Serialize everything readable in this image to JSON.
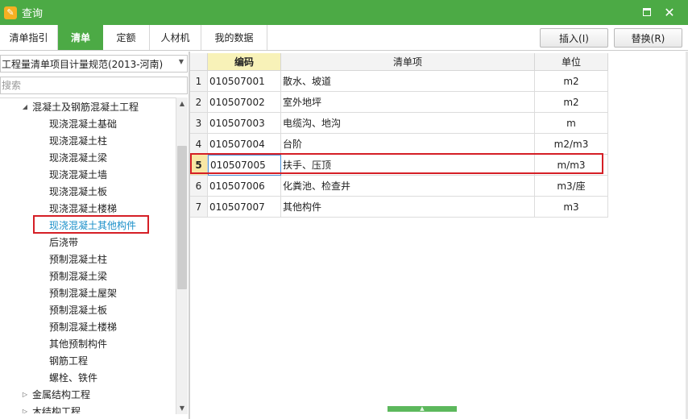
{
  "window": {
    "title": "查询",
    "app_icon": "query-app-icon"
  },
  "tabs": [
    {
      "label": "清单指引",
      "active": false
    },
    {
      "label": "清单",
      "active": true
    },
    {
      "label": "定额",
      "active": false
    },
    {
      "label": "人材机",
      "active": false
    },
    {
      "label": "我的数据",
      "active": false
    }
  ],
  "toolbar": {
    "insert_label": "插入(I)",
    "replace_label": "替换(R)"
  },
  "left_panel": {
    "spec_select": "工程量清单项目计量规范(2013-河南)",
    "search_placeholder": "搜索",
    "tree": {
      "parent": "混凝土及钢筋混凝土工程",
      "children": [
        "现浇混凝土基础",
        "现浇混凝土柱",
        "现浇混凝土梁",
        "现浇混凝土墙",
        "现浇混凝土板",
        "现浇混凝土楼梯",
        "现浇混凝土其他构件",
        "后浇带",
        "预制混凝土柱",
        "预制混凝土梁",
        "预制混凝土屋架",
        "预制混凝土板",
        "预制混凝土楼梯",
        "其他预制构件",
        "钢筋工程",
        "螺栓、铁件"
      ],
      "selected_index": 6,
      "siblings": [
        "金属结构工程",
        "木结构工程"
      ]
    }
  },
  "grid": {
    "columns": {
      "code": "编码",
      "name": "清单项",
      "unit": "单位"
    },
    "rows": [
      {
        "num": "1",
        "code": "010507001",
        "name": "散水、坡道",
        "unit": "m2"
      },
      {
        "num": "2",
        "code": "010507002",
        "name": "室外地坪",
        "unit": "m2"
      },
      {
        "num": "3",
        "code": "010507003",
        "name": "电缆沟、地沟",
        "unit": "m"
      },
      {
        "num": "4",
        "code": "010507004",
        "name": "台阶",
        "unit": "m2/m3"
      },
      {
        "num": "5",
        "code": "010507005",
        "name": "扶手、压顶",
        "unit": "m/m3"
      },
      {
        "num": "6",
        "code": "010507006",
        "name": "化粪池、检查井",
        "unit": "m3/座"
      },
      {
        "num": "7",
        "code": "010507007",
        "name": "其他构件",
        "unit": "m3"
      }
    ],
    "selected_row": 4
  },
  "colors": {
    "accent": "#4caa45",
    "highlight": "#d51f26",
    "selected_text": "#1a8fc9"
  }
}
